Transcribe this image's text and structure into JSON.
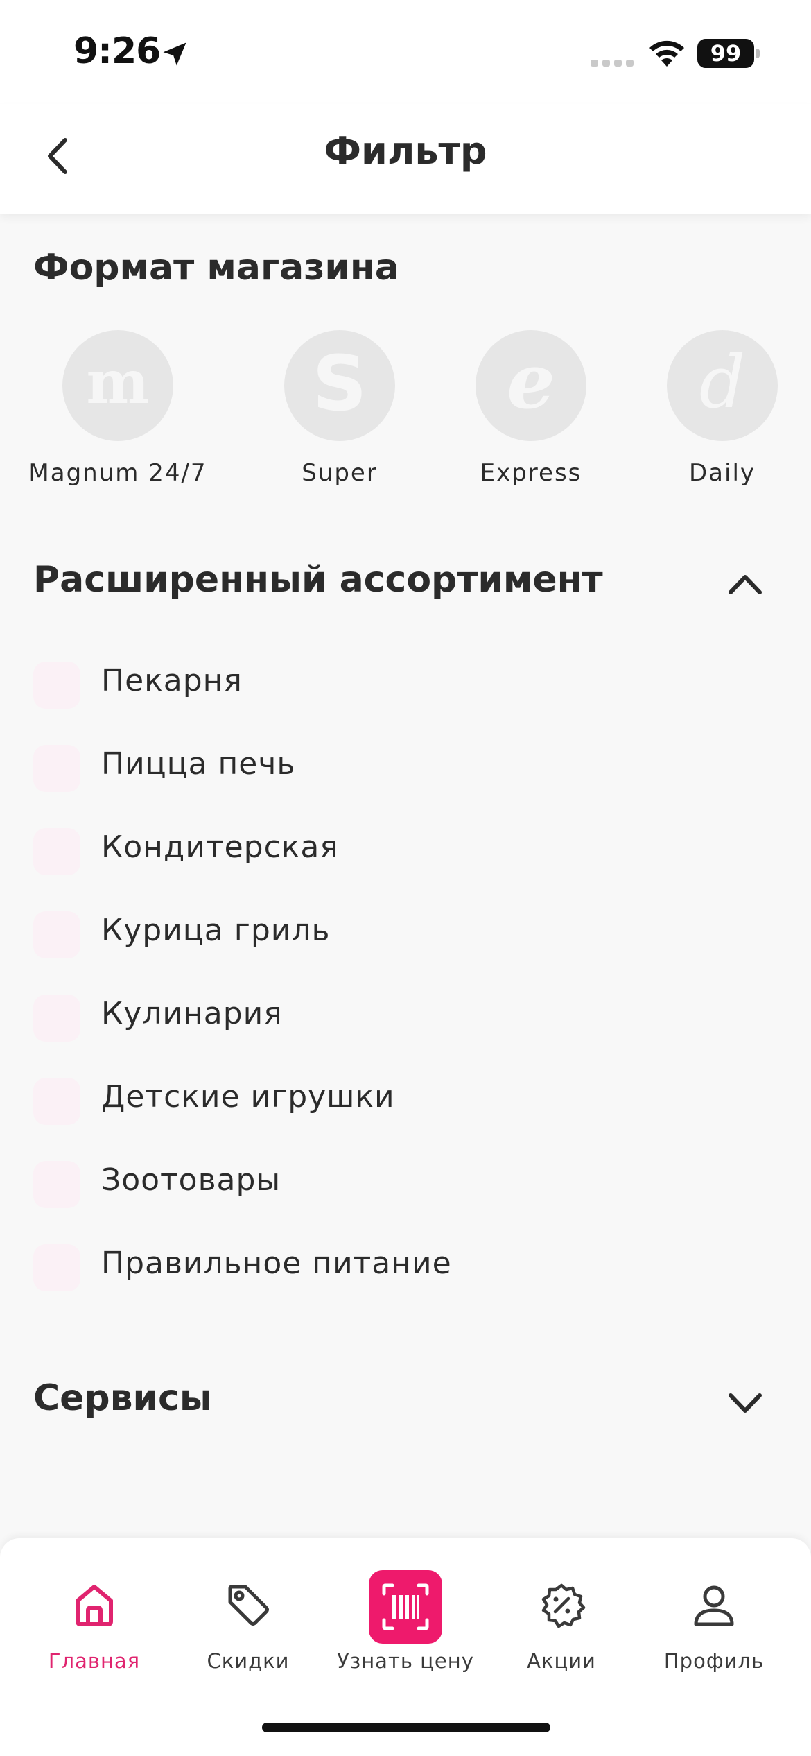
{
  "status_bar": {
    "time": "9:26",
    "battery": "99"
  },
  "header": {
    "title": "Фильтр"
  },
  "store_format": {
    "title": "Формат магазина",
    "items": [
      {
        "label": "Magnum 24/7",
        "glyph": "m"
      },
      {
        "label": "Super",
        "glyph": "S"
      },
      {
        "label": "Express",
        "glyph": "e"
      },
      {
        "label": "Daily",
        "glyph": "d"
      }
    ]
  },
  "assortment": {
    "title": "Расширенный ассортимент",
    "expanded": true,
    "items": [
      {
        "label": "Пекарня",
        "checked": false
      },
      {
        "label": "Пицца печь",
        "checked": false
      },
      {
        "label": "Кондитерская",
        "checked": false
      },
      {
        "label": "Курица гриль",
        "checked": false
      },
      {
        "label": "Кулинария",
        "checked": false
      },
      {
        "label": "Детские игрушки",
        "checked": false
      },
      {
        "label": "Зоотовары",
        "checked": false
      },
      {
        "label": "Правильное питание",
        "checked": false
      }
    ]
  },
  "services": {
    "title": "Сервисы",
    "expanded": false
  },
  "tab_bar": {
    "items": [
      {
        "label": "Главная",
        "icon": "home-icon",
        "active": true
      },
      {
        "label": "Скидки",
        "icon": "tag-icon",
        "active": false
      },
      {
        "label": "Узнать цену",
        "icon": "barcode-scan-icon",
        "active": false
      },
      {
        "label": "Акции",
        "icon": "percent-badge-icon",
        "active": false
      },
      {
        "label": "Профиль",
        "icon": "user-icon",
        "active": false
      }
    ]
  },
  "colors": {
    "accent": "#ee1a6c",
    "active_tab_text": "#e0246f",
    "background": "#f8f8f8"
  }
}
